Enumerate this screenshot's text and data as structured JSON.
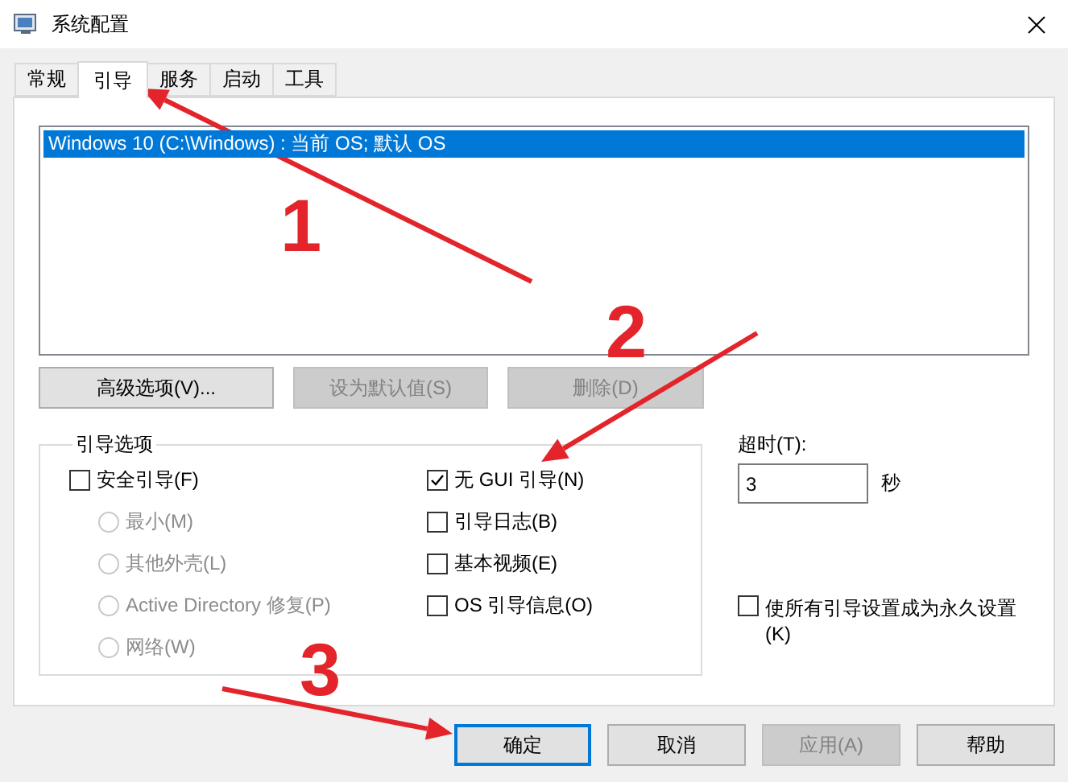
{
  "window": {
    "title": "系统配置"
  },
  "tabs": [
    {
      "label": "常规",
      "selected": false
    },
    {
      "label": "引导",
      "selected": true
    },
    {
      "label": "服务",
      "selected": false
    },
    {
      "label": "启动",
      "selected": false
    },
    {
      "label": "工具",
      "selected": false
    }
  ],
  "boot_list": [
    {
      "label": "Windows 10 (C:\\Windows) : 当前 OS; 默认 OS",
      "selected": true
    }
  ],
  "list_buttons": [
    {
      "label": "高级选项(V)...",
      "disabled": false
    },
    {
      "label": "设为默认值(S)",
      "disabled": true
    },
    {
      "label": "删除(D)",
      "disabled": true
    }
  ],
  "boot_options": {
    "title": "引导选项",
    "safe_boot": {
      "label": "安全引导(F)",
      "checked": false
    },
    "safe_modes": [
      {
        "label": "最小(M)",
        "selected": false,
        "disabled": true
      },
      {
        "label": "其他外壳(L)",
        "selected": false,
        "disabled": true
      },
      {
        "label": "Active Directory 修复(P)",
        "selected": false,
        "disabled": true
      },
      {
        "label": "网络(W)",
        "selected": false,
        "disabled": true
      }
    ],
    "flags": [
      {
        "label": "无 GUI 引导(N)",
        "checked": true
      },
      {
        "label": "引导日志(B)",
        "checked": false
      },
      {
        "label": "基本视频(E)",
        "checked": false
      },
      {
        "label": "OS 引导信息(O)",
        "checked": false
      }
    ]
  },
  "timeout": {
    "label": "超时(T):",
    "value": "3",
    "unit": "秒"
  },
  "make_permanent": {
    "label": "使所有引导设置成为永久设置(K)",
    "checked": false
  },
  "buttons": [
    {
      "label": "确定",
      "default": true,
      "disabled": false
    },
    {
      "label": "取消",
      "default": false,
      "disabled": false
    },
    {
      "label": "应用(A)",
      "default": false,
      "disabled": true
    },
    {
      "label": "帮助",
      "default": false,
      "disabled": false
    }
  ],
  "annotations": [
    {
      "label": "1"
    },
    {
      "label": "2"
    },
    {
      "label": "3"
    }
  ]
}
